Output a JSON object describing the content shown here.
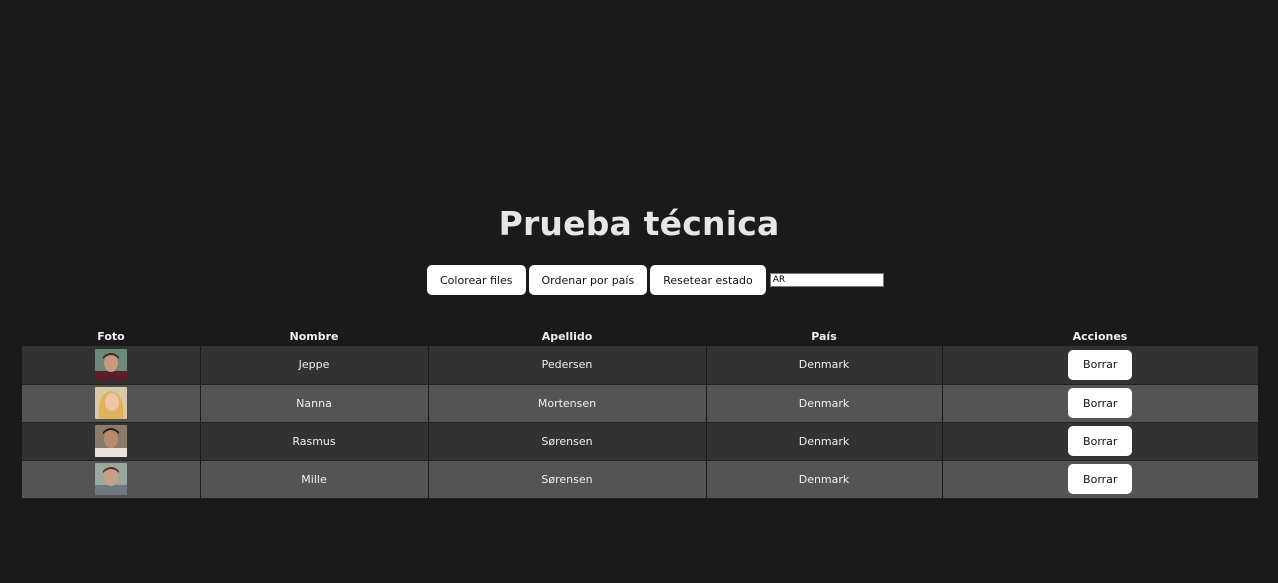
{
  "page": {
    "title": "Prueba técnica"
  },
  "toolbar": {
    "color_rows_label": "Colorear files",
    "sort_country_label": "Ordenar por país",
    "reset_label": "Resetear estado",
    "filter_value": "AR"
  },
  "table": {
    "headers": [
      "Foto",
      "Nombre",
      "Apellido",
      "País",
      "Acciones"
    ],
    "rows": [
      {
        "first": "Jeppe",
        "last": "Pedersen",
        "country": "Denmark",
        "action": "Borrar"
      },
      {
        "first": "Nanna",
        "last": "Mortensen",
        "country": "Denmark",
        "action": "Borrar"
      },
      {
        "first": "Rasmus",
        "last": "Sørensen",
        "country": "Denmark",
        "action": "Borrar"
      },
      {
        "first": "Mille",
        "last": "Sørensen",
        "country": "Denmark",
        "action": "Borrar"
      }
    ]
  },
  "colors": {
    "background": "#1b1a1b",
    "row_dark": "#333233",
    "row_light": "#555455",
    "button": "#ffffff"
  }
}
